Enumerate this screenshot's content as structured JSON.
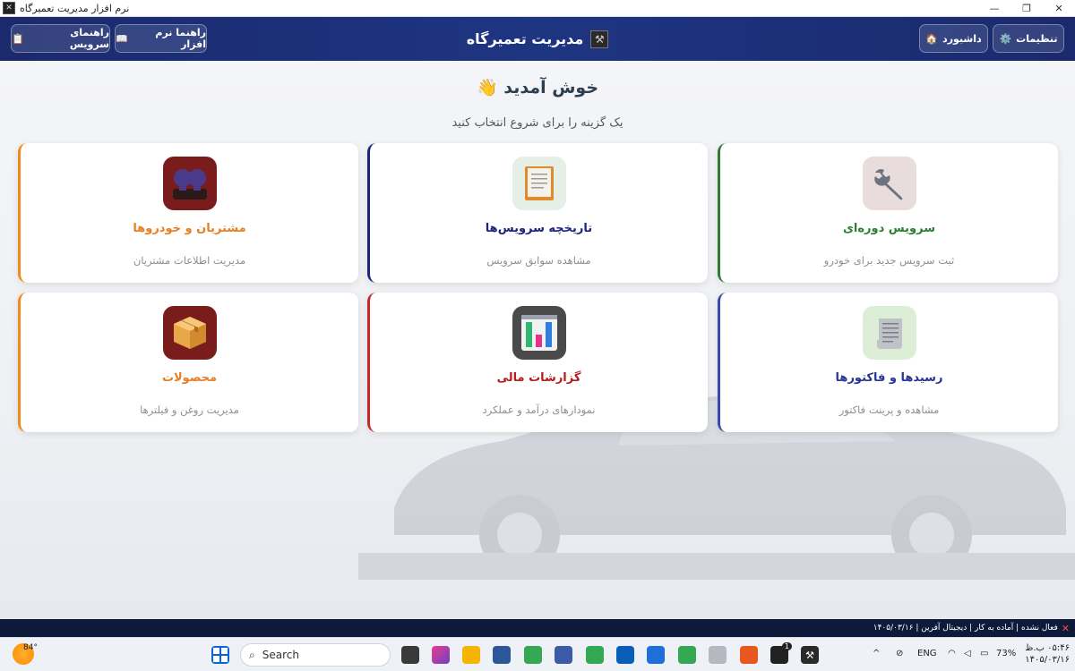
{
  "window": {
    "title": "نرم افزار مدیریت تعمیرگاه",
    "controls": {
      "minimize": "—",
      "maximize": "❐",
      "close": "✕"
    }
  },
  "header": {
    "title": "مدیریت تعمیرگاه",
    "logo_icon": "wrench-hammer-icon",
    "right_buttons": [
      {
        "label": "تنظیمات",
        "icon": "gear-icon",
        "glyph": "⚙️"
      },
      {
        "label": "داشبورد",
        "icon": "house-icon",
        "glyph": "🏠"
      }
    ],
    "left_buttons": [
      {
        "label": "راهنما نرم افزار",
        "icon": "book-icon",
        "glyph": "📖"
      },
      {
        "label": "راهنمای سرویس",
        "icon": "clipboard-icon",
        "glyph": "📋"
      }
    ]
  },
  "main": {
    "welcome": "خوش آمدید",
    "welcome_icon": "👋",
    "subtitle": "یک گزینه را برای شروع انتخاب کنید"
  },
  "cards": [
    {
      "id": "periodic-service",
      "title": "سرویس دوره‌ای",
      "desc": "ثبت سرویس جدید برای خودرو",
      "accent": "#2e7d32",
      "title_color": "#2e7d32",
      "icon": "wrench-icon",
      "icon_bg": "#e8dcdc"
    },
    {
      "id": "service-history",
      "title": "تاریخچه سرویس‌ها",
      "desc": "مشاهده سوابق سرویس",
      "accent": "#1a237e",
      "title_color": "#1a237e",
      "icon": "notebook-icon",
      "icon_bg": "#e6efe6"
    },
    {
      "id": "customers-vehicles",
      "title": "مشتریان و خودروها",
      "desc": "مدیریت اطلاعات مشتریان",
      "accent": "#ef8b1a",
      "title_color": "#e67e22",
      "icon": "users-icon",
      "icon_bg": "#7a1c1c"
    },
    {
      "id": "receipts-invoices",
      "title": "رسیدها و فاکتورها",
      "desc": "مشاهده و پرینت فاکتور",
      "accent": "#3949ab",
      "title_color": "#283593",
      "icon": "receipt-icon",
      "icon_bg": "#dcefd6"
    },
    {
      "id": "financial-reports",
      "title": "گزارشات مالی",
      "desc": "نمودارهای درآمد و عملکرد",
      "accent": "#c62828",
      "title_color": "#b71c1c",
      "icon": "bar-chart-icon",
      "icon_bg": "#4a4a4a"
    },
    {
      "id": "products",
      "title": "محصولات",
      "desc": "مدیریت روغن و فیلترها",
      "accent": "#ef8b1a",
      "title_color": "#e67e22",
      "icon": "box-icon",
      "icon_bg": "#7a1c1c"
    }
  ],
  "statusbar": {
    "text": "فعال نشده | آماده به کار | دیجیتال آفرین | ۱۴۰۵/۰۳/۱۶"
  },
  "taskbar": {
    "weather_temp": "84°",
    "search_placeholder": "Search",
    "language": "ENG",
    "battery": "73%",
    "time": "۰۵:۴۶ ب.ظ",
    "date": "۱۴۰۵/۰۳/۱۶",
    "badge": "1"
  }
}
